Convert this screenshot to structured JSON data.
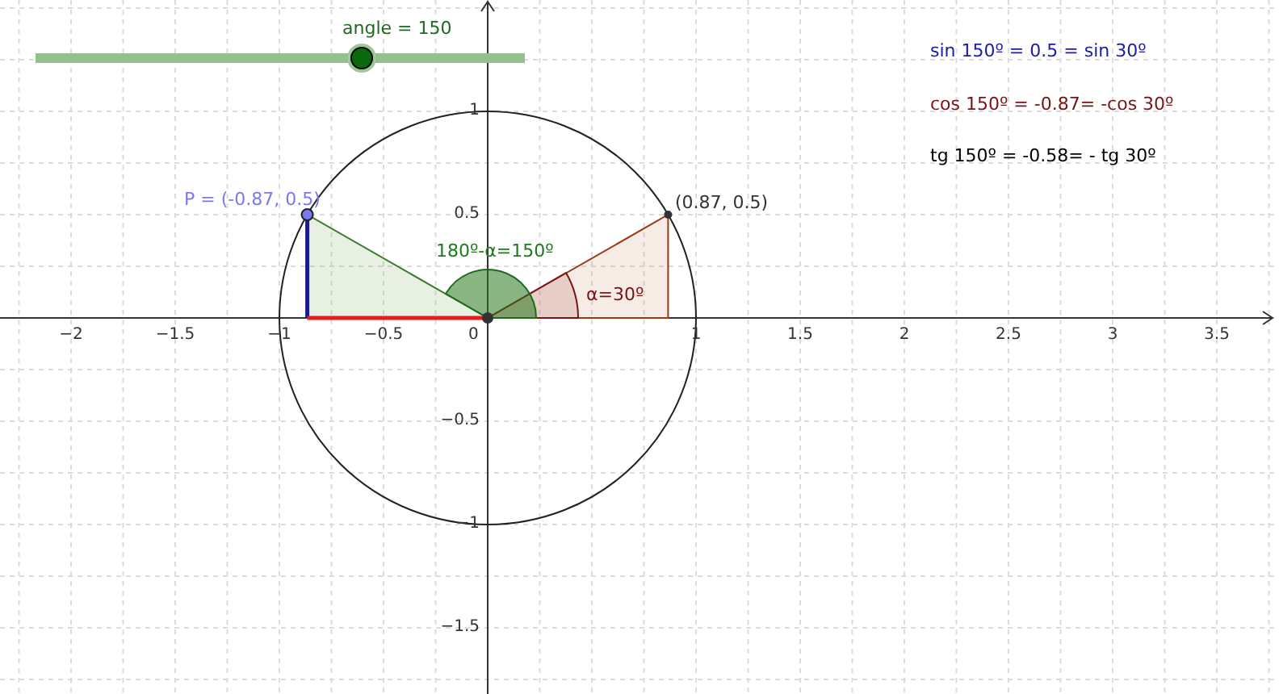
{
  "slider": {
    "label": "angle = 150",
    "level": 0.663
  },
  "formulas": [
    {
      "text": "sin 150º = 0.5 =  sin 30º",
      "color": "#1c1ca8"
    },
    {
      "text": "cos 150º = -0.87= -cos 30º",
      "color": "#7a1414"
    },
    {
      "text": "tg 150º = -0.58= - tg 30º",
      "color": "#000000"
    }
  ],
  "labels": {
    "point_p": "P = (-0.87, 0.5)",
    "point_q": "(0.87, 0.5)",
    "obtuse_angle": "180º-α=150º",
    "acute_angle": "α=30º"
  },
  "x_ticks": [
    "−2",
    "−1.5",
    "−1",
    "−0.5",
    "1",
    "1.5",
    "2",
    "2.5",
    "3",
    "3.5"
  ],
  "y_ticks": [
    "1",
    "0.5",
    "−0.5",
    "−1",
    "−1.5"
  ],
  "origin": "0"
}
